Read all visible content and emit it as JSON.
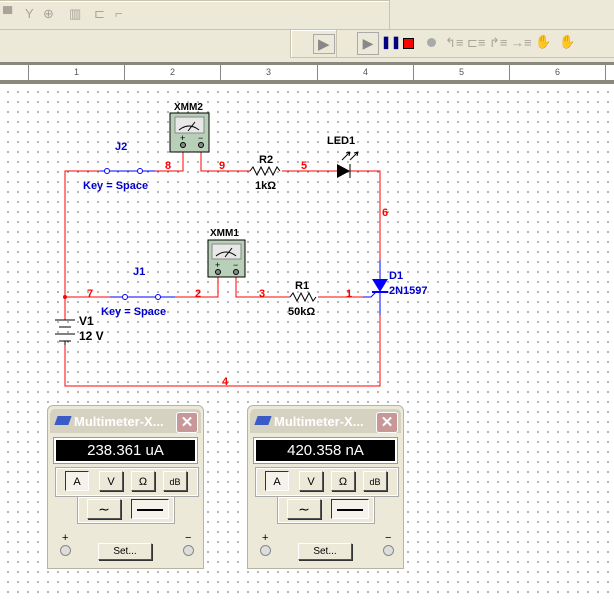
{
  "toolbar": {
    "icons": [
      "component-icon",
      "antenna-icon",
      "relay-icon",
      "chip-icon",
      "hierarchy-icon",
      "step-icon"
    ],
    "sim_controls": [
      "play-icon",
      "pause-icon",
      "stop-icon",
      "record-icon",
      "step-into-icon",
      "step-over-icon",
      "step-out-icon",
      "run-to-cursor-icon",
      "breakpoint-icon",
      "remove-breakpoints-icon"
    ]
  },
  "ruler": {
    "marks": [
      "1",
      "2",
      "3",
      "4",
      "5",
      "6"
    ]
  },
  "circuit": {
    "xmm2": "XMM2",
    "xmm1": "XMM1",
    "j2": "J2",
    "j1": "J1",
    "key": "Key = Space",
    "r2": "R2",
    "r2_val": "1kΩ",
    "r1": "R1",
    "r1_val": "50kΩ",
    "led": "LED1",
    "d1": "D1",
    "d1_model": "2N1597",
    "v1": "V1",
    "v1_val": "12 V",
    "nodes": {
      "n1": "1",
      "n2": "2",
      "n3": "3",
      "n4": "4",
      "n5": "5",
      "n6": "6",
      "n7": "7",
      "n8": "8",
      "n9": "9"
    },
    "plus": "+",
    "minus": "−"
  },
  "multimeters": [
    {
      "title": "Multimeter-X...",
      "reading": "238.361 uA",
      "buttons": [
        "A",
        "V",
        "Ω",
        "dB"
      ],
      "active": "A",
      "set": "Set...",
      "plus": "+",
      "minus": "−"
    },
    {
      "title": "Multimeter-X...",
      "reading": "420.358 nA",
      "buttons": [
        "A",
        "V",
        "Ω",
        "dB"
      ],
      "active": "A",
      "set": "Set...",
      "plus": "+",
      "minus": "−"
    }
  ],
  "colors": {
    "wire": "#ff0000",
    "switch": "#0000ff",
    "label": "#0000cc",
    "node": "#ff0000"
  }
}
